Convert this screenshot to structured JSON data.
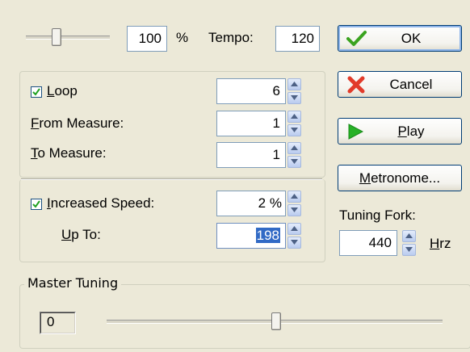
{
  "tempo_slider": {
    "value_fraction": 0.35
  },
  "speed": {
    "value": "100",
    "unit": "%"
  },
  "tempo": {
    "label": "Tempo:",
    "value": "120"
  },
  "buttons": {
    "ok": "OK",
    "cancel": "Cancel",
    "play": "Play",
    "metronome": "Metronome..."
  },
  "loop_group": {
    "loop": {
      "label": "Loop",
      "checked": true,
      "value": "6"
    },
    "from_measure": {
      "label": "From Measure:",
      "value": "1"
    },
    "to_measure": {
      "label": "To Measure:",
      "value": "1"
    }
  },
  "increase_group": {
    "increased_speed": {
      "label": "Increased Speed:",
      "checked": true,
      "value": "2",
      "unit": "%"
    },
    "up_to": {
      "label": "Up To:",
      "value": "198"
    }
  },
  "tuning_fork": {
    "label": "Tuning Fork:",
    "value": "440",
    "unit": "Hrz"
  },
  "master_tuning": {
    "label": "Master Tuning",
    "value": "0",
    "slider_fraction": 0.5
  },
  "icons": {
    "ok": "check-icon",
    "cancel": "x-icon",
    "play": "play-icon"
  },
  "colors": {
    "ok_check": "#3aa31f",
    "cancel_x": "#e23b2a",
    "play_triangle": "#27b127",
    "selection": "#316ac5"
  }
}
